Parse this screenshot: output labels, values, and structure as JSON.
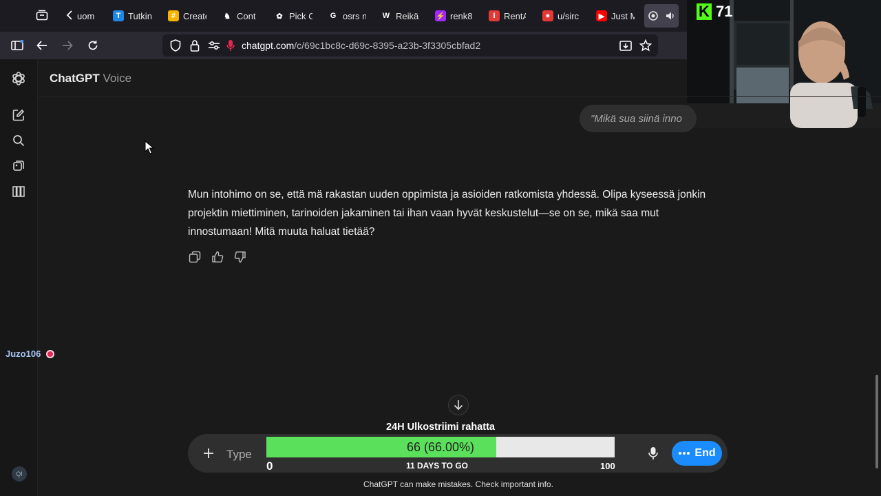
{
  "browser": {
    "tabs": [
      {
        "label": "uom",
        "color": "#3a3a3a",
        "glyph": ""
      },
      {
        "label": "Tutkin",
        "color": "#1e88e5",
        "glyph": "T"
      },
      {
        "label": "Create",
        "color": "#f4b400",
        "glyph": "#"
      },
      {
        "label": "Conta",
        "color": "#ffffff",
        "glyph": "♞"
      },
      {
        "label": "Pick C",
        "color": "#ffffff",
        "glyph": "✿"
      },
      {
        "label": "osrs n",
        "color": "#ffffff",
        "glyph": "G"
      },
      {
        "label": "Reikä",
        "color": "#ffffff",
        "glyph": "W"
      },
      {
        "label": "renk8",
        "color": "#9c27ff",
        "glyph": "⚡"
      },
      {
        "label": "RentA",
        "color": "#e53935",
        "glyph": "I"
      },
      {
        "label": "u/sirc",
        "color": "#e53935",
        "glyph": "●"
      },
      {
        "label": "Just M",
        "color": "#ff0000",
        "glyph": "▶"
      }
    ],
    "url_domain": "chatgpt.com",
    "url_path": "/c/69c1bc8c-d69c-8395-a23b-3f3305cbfad2"
  },
  "header": {
    "brand": "ChatGPT",
    "mode": "Voice"
  },
  "conversation": {
    "user_message": "\"Mikä sua siinä inno",
    "assistant_message": "Mun intohimo on se, että mä rakastan uuden oppimista ja asioiden ratkomista yhdessä. Olipa kyseessä jonkin projektin miettiminen, tarinoiden jakaminen tai ihan vaan hyvät keskustelut—se on se, mikä saa mut innostumaan! Mitä muuta haluat tietää?"
  },
  "stream": {
    "viewer_count": "71",
    "chat_user": "Juzo106",
    "goal_title": "24H Ulkostriimi rahatta",
    "goal_value_label": "66 (66.00%)",
    "goal_progress": 0.66,
    "goal_min": "0",
    "goal_max": "100",
    "goal_days": "11 DAYS TO GO"
  },
  "composer": {
    "placeholder": "Type",
    "end_label": "End"
  },
  "footer": {
    "disclaimer": "ChatGPT can make mistakes. Check important info.",
    "badge": "QI"
  }
}
